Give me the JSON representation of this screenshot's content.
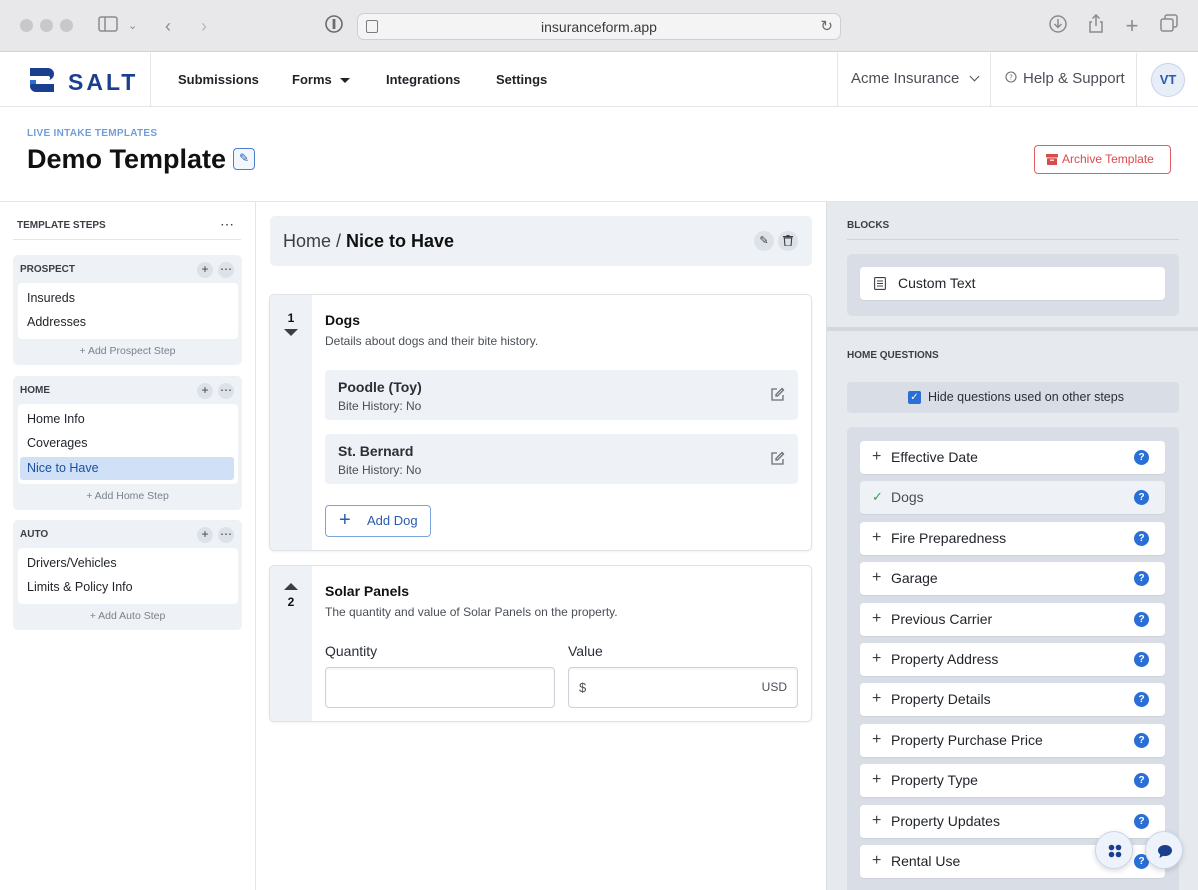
{
  "browser": {
    "url": "insuranceform.app"
  },
  "app": {
    "logo_text": "SALT",
    "nav": [
      "Submissions",
      "Forms",
      "Integrations",
      "Settings"
    ],
    "org": "Acme Insurance",
    "help": "Help & Support",
    "avatar": "VT"
  },
  "page": {
    "eyebrow": "LIVE INTAKE TEMPLATES",
    "title": "Demo Template",
    "archive_label": "Archive Template"
  },
  "sidebar": {
    "heading": "TEMPLATE STEPS",
    "groups": [
      {
        "title": "PROSPECT",
        "items": [
          "Insureds",
          "Addresses"
        ],
        "add": "+ Add Prospect Step"
      },
      {
        "title": "HOME",
        "items": [
          "Home Info",
          "Coverages",
          "Nice to Have"
        ],
        "add": "+ Add Home Step",
        "active": "Nice to Have"
      },
      {
        "title": "AUTO",
        "items": [
          "Drivers/Vehicles",
          "Limits & Policy Info"
        ],
        "add": "+ Add Auto Step"
      }
    ]
  },
  "breadcrumb": {
    "parent": "Home /",
    "current": "Nice to Have"
  },
  "questions": [
    {
      "number": "1",
      "title": "Dogs",
      "description": "Details about dogs and their bite history.",
      "dogs": [
        {
          "name": "Poodle (Toy)",
          "detail": "Bite History: No"
        },
        {
          "name": "St. Bernard",
          "detail": "Bite History: No"
        }
      ],
      "add_label": "Add Dog"
    },
    {
      "number": "2",
      "title": "Solar Panels",
      "description": "The quantity and value of Solar Panels on the property.",
      "quantity_label": "Quantity",
      "value_label": "Value",
      "value_prefix": "$",
      "value_suffix": "USD"
    }
  ],
  "right_panel": {
    "blocks_heading": "BLOCKS",
    "block": "Custom Text",
    "questions_heading": "HOME QUESTIONS",
    "hide_label": "Hide questions used on other steps",
    "items": [
      {
        "label": "Effective Date",
        "used": false
      },
      {
        "label": "Dogs",
        "used": true
      },
      {
        "label": "Fire Preparedness",
        "used": false
      },
      {
        "label": "Garage",
        "used": false
      },
      {
        "label": "Previous Carrier",
        "used": false
      },
      {
        "label": "Property Address",
        "used": false
      },
      {
        "label": "Property Details",
        "used": false
      },
      {
        "label": "Property Purchase Price",
        "used": false
      },
      {
        "label": "Property Type",
        "used": false
      },
      {
        "label": "Property Updates",
        "used": false
      },
      {
        "label": "Rental Use",
        "used": false
      }
    ]
  },
  "colors": {
    "brand": "#1a3f8f",
    "accent": "#2a6fd6",
    "danger": "#d94a4a",
    "active_bg": "#cfe0f7"
  }
}
